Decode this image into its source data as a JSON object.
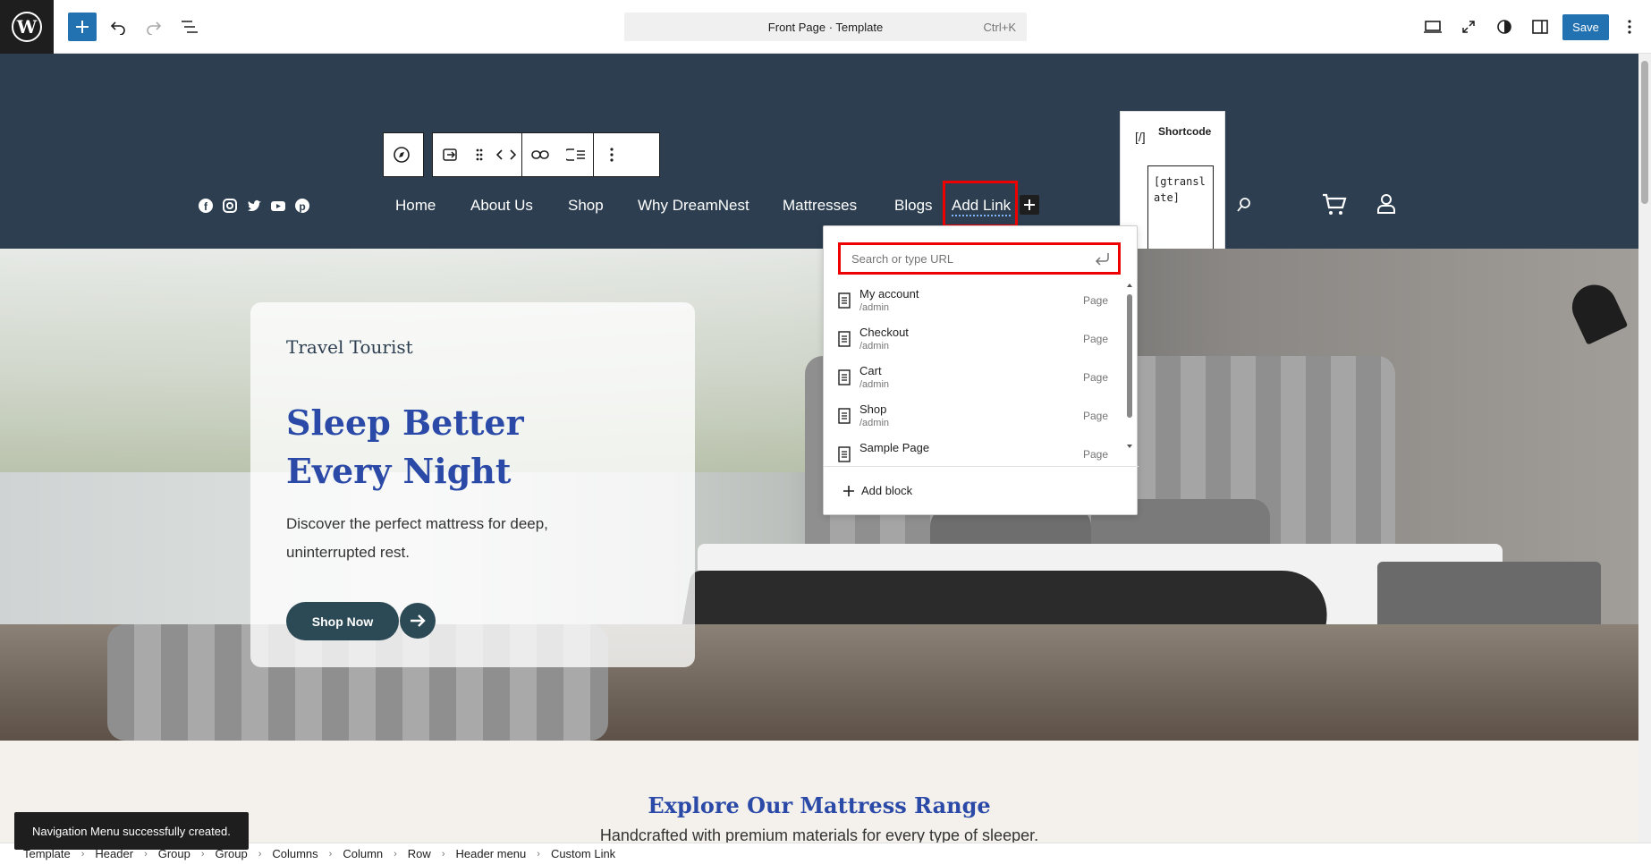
{
  "topbar": {
    "command_title": "Front Page · Template",
    "command_shortcut": "Ctrl+K",
    "save_label": "Save"
  },
  "header": {
    "nav": [
      "Home",
      "About Us",
      "Shop",
      "Why DreamNest",
      "Mattresses",
      "Blogs",
      "Add Link"
    ],
    "social_icons": [
      "facebook-icon",
      "instagram-icon",
      "twitter-icon",
      "youtube-icon",
      "pinterest-icon"
    ]
  },
  "shortcode": {
    "label": "Shortcode",
    "value": "[gtranslate]"
  },
  "link_popover": {
    "placeholder": "Search or type URL",
    "suggestions": [
      {
        "title": "My account",
        "path": "/admin",
        "type": "Page"
      },
      {
        "title": "Checkout",
        "path": "/admin",
        "type": "Page"
      },
      {
        "title": "Cart",
        "path": "/admin",
        "type": "Page"
      },
      {
        "title": "Shop",
        "path": "/admin",
        "type": "Page"
      },
      {
        "title": "Sample Page",
        "path": "",
        "type": "Page"
      }
    ],
    "add_block": "Add block"
  },
  "hero": {
    "eyebrow": "Travel Tourist",
    "title": "Sleep Better Every Night",
    "description": "Discover the perfect mattress for deep, uninterrupted rest.",
    "button": "Shop Now"
  },
  "section": {
    "title": "Explore Our Mattress Range",
    "subtitle": "Handcrafted with premium materials for every type of sleeper."
  },
  "breadcrumb": [
    "Template",
    "Header",
    "Group",
    "Group",
    "Columns",
    "Column",
    "Row",
    "Header menu",
    "Custom Link"
  ],
  "snackbar": "Navigation Menu successfully created.",
  "colors": {
    "header_bg": "#2c3e50",
    "accent": "#2271b1",
    "highlight": "#e00000",
    "heading_blue": "#2b4aa8"
  }
}
